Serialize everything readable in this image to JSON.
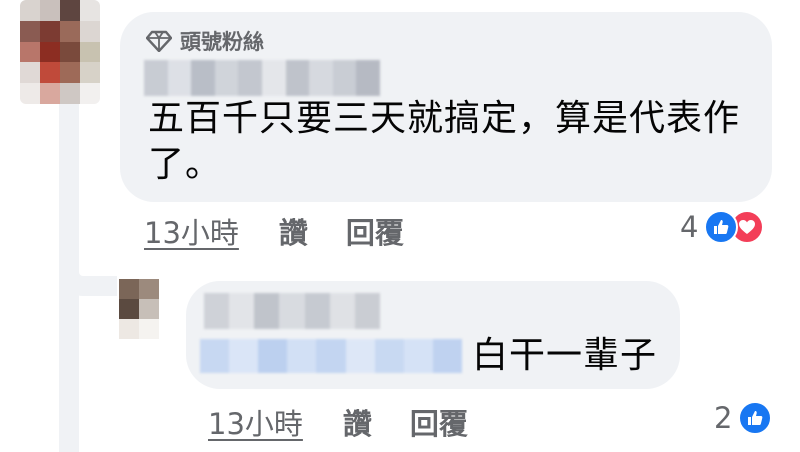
{
  "colors": {
    "bubble_bg": "#f0f2f5",
    "secondary_text": "#65676b",
    "like_blue": "#1877f2",
    "love_red": "#f33e58"
  },
  "comments": [
    {
      "badge_icon": "diamond-icon",
      "badge_label": "頭號粉絲",
      "text": "五百千只要三天就搞定，算是代表作了。",
      "timestamp": "13小時",
      "like_label": "讚",
      "reply_label": "回覆",
      "reaction_count": "4",
      "reaction_icons": [
        "like-icon",
        "love-icon"
      ]
    },
    {
      "text": "白干一輩子",
      "timestamp": "13小時",
      "like_label": "讚",
      "reply_label": "回覆",
      "reaction_count": "2",
      "reaction_icons": [
        "like-icon"
      ]
    }
  ]
}
